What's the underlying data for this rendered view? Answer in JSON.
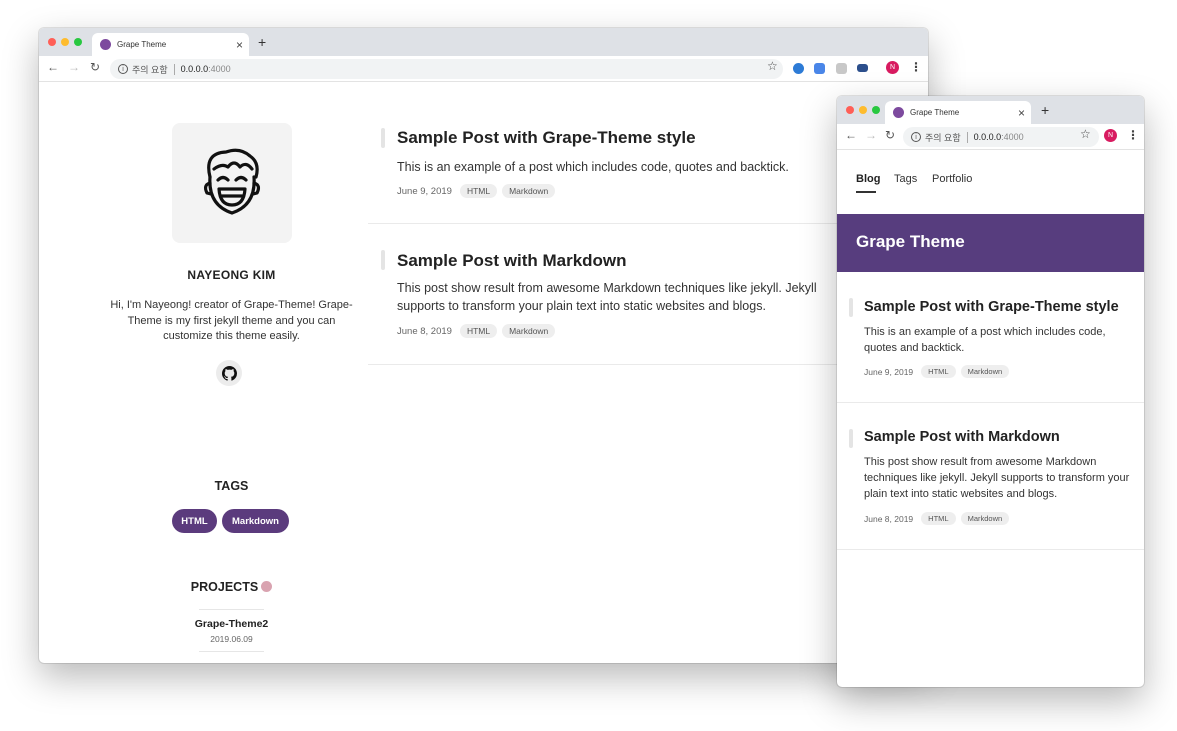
{
  "browser": {
    "tab_title": "Grape Theme",
    "tab_close": "×",
    "new_tab": "+",
    "back": "←",
    "forward": "→",
    "reload": "↻",
    "info_icon": "i",
    "security_label": "주의 요함",
    "url_host": "0.0.0.0",
    "url_port": ":4000",
    "bookmark": "☆",
    "profile_initial": "N",
    "menu": "⋮"
  },
  "colors": {
    "brand_purple": "#573d7e",
    "tag_purple": "#5b3b7d",
    "favicon": "#7d4a9e",
    "profile_red": "#d81b60"
  },
  "sidebar": {
    "author_name": "NAYEONG KIM",
    "bio": "Hi, I'm Nayeong! creator of Grape-Theme! Grape-Theme is my first jekyll theme and you can customize this theme easily.",
    "social_icon": "github-icon",
    "tags_heading": "TAGS",
    "tags": [
      "HTML",
      "Markdown"
    ],
    "projects_heading": "PROJECTS",
    "projects_emoji": "person-emoji",
    "projects": [
      {
        "name": "Grape-Theme2",
        "date": "2019.06.09"
      }
    ]
  },
  "posts": [
    {
      "title": "Sample Post with Grape-Theme style",
      "excerpt": "This is an example of a post which includes code, quotes and backtick.",
      "date": "June 9, 2019",
      "tags": [
        "HTML",
        "Markdown"
      ]
    },
    {
      "title": "Sample Post with Markdown",
      "excerpt": "This post show result from awesome Markdown techniques like jekyll. Jekyll supports to transform your plain text into static websites and blogs.",
      "date": "June 8, 2019",
      "tags": [
        "HTML",
        "Markdown"
      ]
    }
  ],
  "mobile": {
    "nav": [
      "Blog",
      "Tags",
      "Portfolio"
    ],
    "active_nav": "Blog",
    "banner_title": "Grape Theme"
  }
}
